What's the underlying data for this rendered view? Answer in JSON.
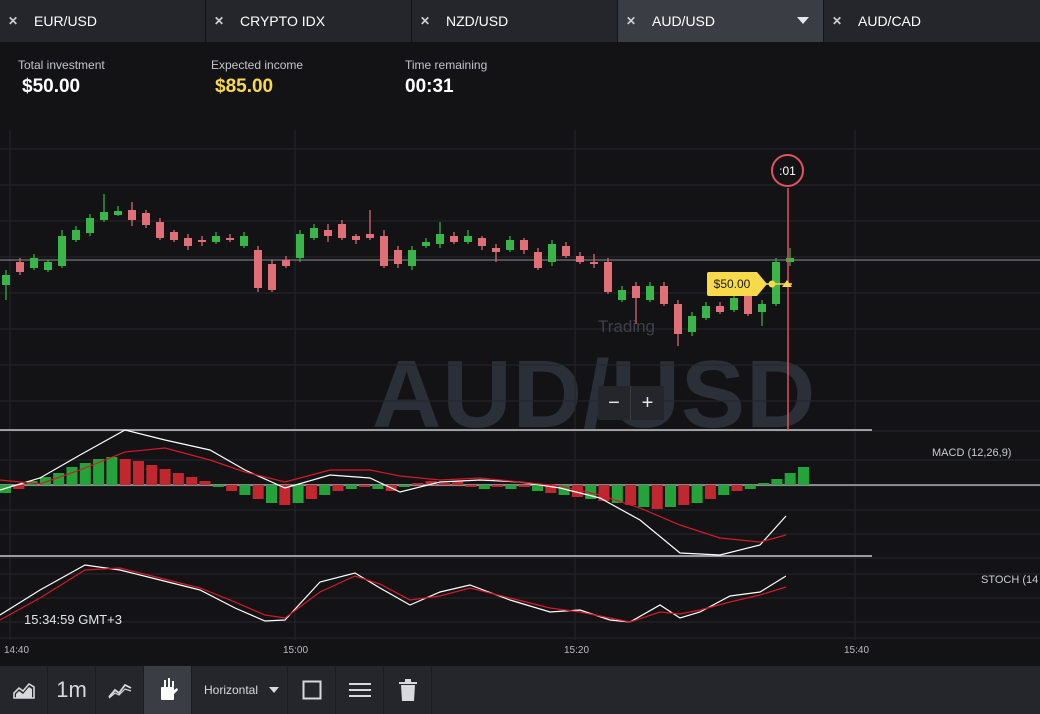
{
  "tabs": [
    {
      "label": "EUR/USD",
      "close": "✕",
      "active": false
    },
    {
      "label": "CRYPTO IDX",
      "close": "✕",
      "active": false
    },
    {
      "label": "NZD/USD",
      "close": "✕",
      "active": false
    },
    {
      "label": "AUD/USD",
      "close": "✕",
      "active": true
    },
    {
      "label": "AUD/CAD",
      "close": "✕",
      "active": false
    }
  ],
  "info": {
    "total_investment_label": "Total investment",
    "total_investment_value": "$50.00",
    "expected_income_label": "Expected income",
    "expected_income_value": "$85.00",
    "time_remaining_label": "Time remaining",
    "time_remaining_value": "00:31"
  },
  "chart": {
    "watermark": "AUD/USD",
    "status_text": "Trading",
    "timer_badge": ":01",
    "price_tag": "$50.00",
    "zoom_out": "−",
    "zoom_in": "+",
    "macd_label": "MACD (12,26,9)",
    "stoch_label": "STOCH (14",
    "clock": "15:34:59 GMT+3",
    "x_ticks": [
      "14:40",
      "15:00",
      "15:20",
      "15:40"
    ],
    "colors": {
      "up": "#39b54a",
      "down": "#e06f78",
      "signal": "#d31a28",
      "line": "#ffffff",
      "expiry": "#e2535e",
      "tag": "#f8d94a"
    }
  },
  "toolbar": {
    "chart_type_icon": "area-chart-icon",
    "timeframe": "1m",
    "indicators_icon": "indicators-icon",
    "drawing_icon": "pen-tool-icon",
    "drawing_mode": "Horizontal",
    "rect_icon": "rectangle-icon",
    "lines_icon": "lines-icon",
    "delete_icon": "trash-icon"
  }
}
